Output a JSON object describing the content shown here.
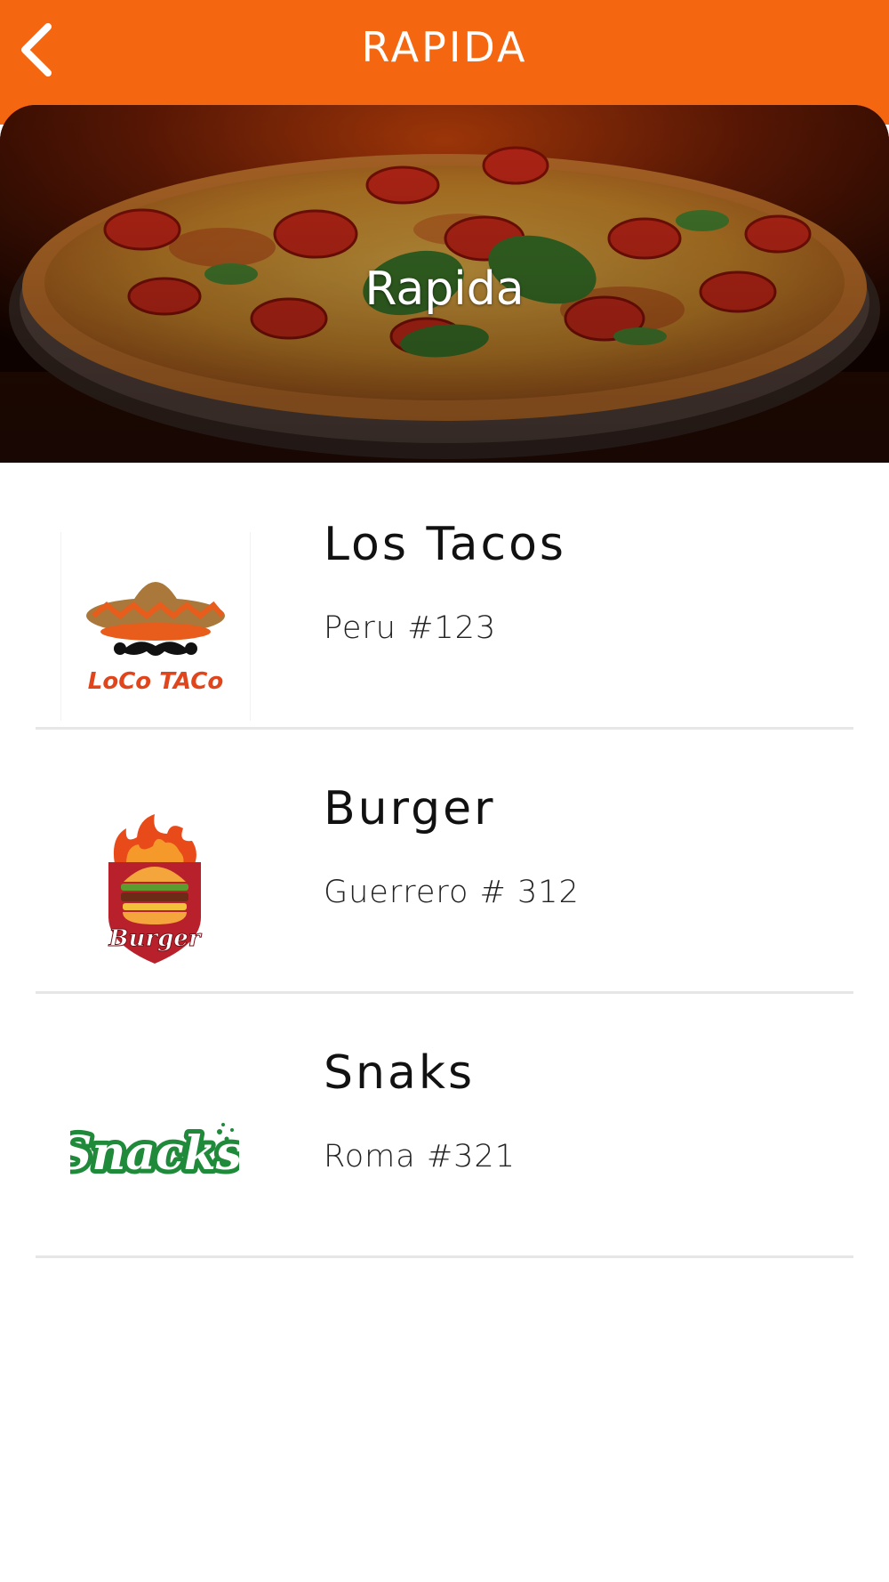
{
  "header": {
    "title": "RAPIDA",
    "background_color": "#f4660f",
    "back_icon": "chevron-left-icon"
  },
  "hero": {
    "title": "Rapida",
    "image": "pizza-photo"
  },
  "restaurants": [
    {
      "name": "Los Tacos",
      "address": "Peru #123",
      "logo": "loco-taco-logo",
      "logo_text": "LoCo TACo"
    },
    {
      "name": "Burger",
      "address": "Guerrero # 312",
      "logo": "burger-logo",
      "logo_text": "Burger"
    },
    {
      "name": "Snaks",
      "address": "Roma #321",
      "logo": "snacks-logo",
      "logo_text": "Snacks"
    }
  ]
}
